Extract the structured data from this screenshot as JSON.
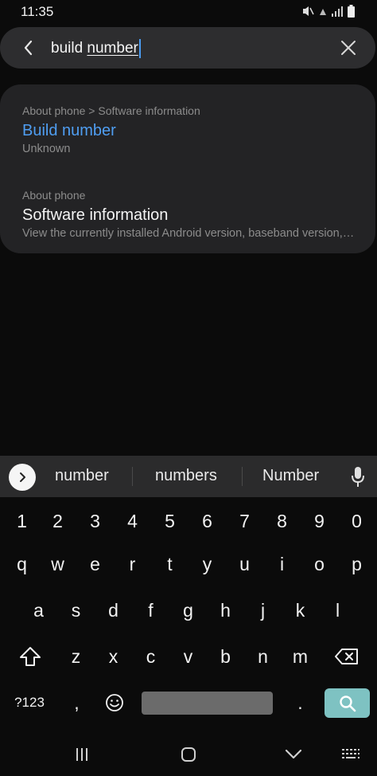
{
  "status_bar": {
    "time": "11:35",
    "icons": [
      "mute-vibrate-icon",
      "wifi-icon",
      "signal-icon",
      "battery-icon"
    ]
  },
  "search": {
    "query_prefix": "build ",
    "query_underlined": "number",
    "back_icon": "back-arrow-icon",
    "clear_icon": "close-icon",
    "accent_color": "#4a9bf0"
  },
  "results": [
    {
      "path": "About phone > Software information",
      "title": "Build number",
      "subtitle": "Unknown",
      "highlight_color": "#4f9ef2"
    },
    {
      "path": "About phone",
      "title": "Software information",
      "subtitle": "View the currently installed Android version, baseband version, kernel version, build number"
    }
  ],
  "suggestions": [
    "number",
    "numbers",
    "Number"
  ],
  "keyboard": {
    "numbers": [
      "1",
      "2",
      "3",
      "4",
      "5",
      "6",
      "7",
      "8",
      "9",
      "0"
    ],
    "row_q": [
      "q",
      "w",
      "e",
      "r",
      "t",
      "y",
      "u",
      "i",
      "o",
      "p"
    ],
    "row_a": [
      "a",
      "s",
      "d",
      "f",
      "g",
      "h",
      "j",
      "k",
      "l"
    ],
    "row_z": [
      "z",
      "x",
      "c",
      "v",
      "b",
      "n",
      "m"
    ],
    "symbols_label": "?123",
    "comma": ",",
    "period": ".",
    "search_key_color": "#7ec2c2"
  },
  "nav_bar": {
    "icons": [
      "recent-apps-icon",
      "home-icon",
      "back-icon",
      "keyboard-switch-icon"
    ]
  }
}
